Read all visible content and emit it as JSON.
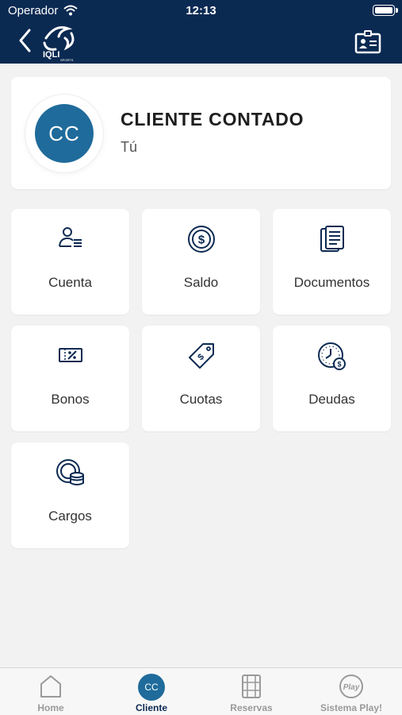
{
  "status": {
    "carrier": "Operador",
    "time": "12:13"
  },
  "nav": {
    "logo_text": "IQLI",
    "logo_subtext": "SPORTS"
  },
  "profile": {
    "initials": "CC",
    "name": "CLIENTE CONTADO",
    "subtitle": "Tú"
  },
  "tiles": [
    {
      "label": "Cuenta",
      "icon": "user-list-icon"
    },
    {
      "label": "Saldo",
      "icon": "dollar-coin-icon"
    },
    {
      "label": "Documentos",
      "icon": "documents-icon"
    },
    {
      "label": "Bonos",
      "icon": "percent-ticket-icon"
    },
    {
      "label": "Cuotas",
      "icon": "price-tag-icon"
    },
    {
      "label": "Deudas",
      "icon": "clock-coin-icon"
    },
    {
      "label": "Cargos",
      "icon": "coin-stack-icon"
    }
  ],
  "tabs": [
    {
      "label": "Home",
      "icon": "home-icon"
    },
    {
      "label": "Cliente",
      "initials": "CC",
      "active": true
    },
    {
      "label": "Reservas",
      "icon": "film-grid-icon"
    },
    {
      "label": "Sistema Play!",
      "icon": "play-badge-icon",
      "badge_text": "Play"
    }
  ],
  "colors": {
    "navy": "#0b2a52",
    "accent": "#1f6b9b",
    "background": "#f2f2f2"
  }
}
